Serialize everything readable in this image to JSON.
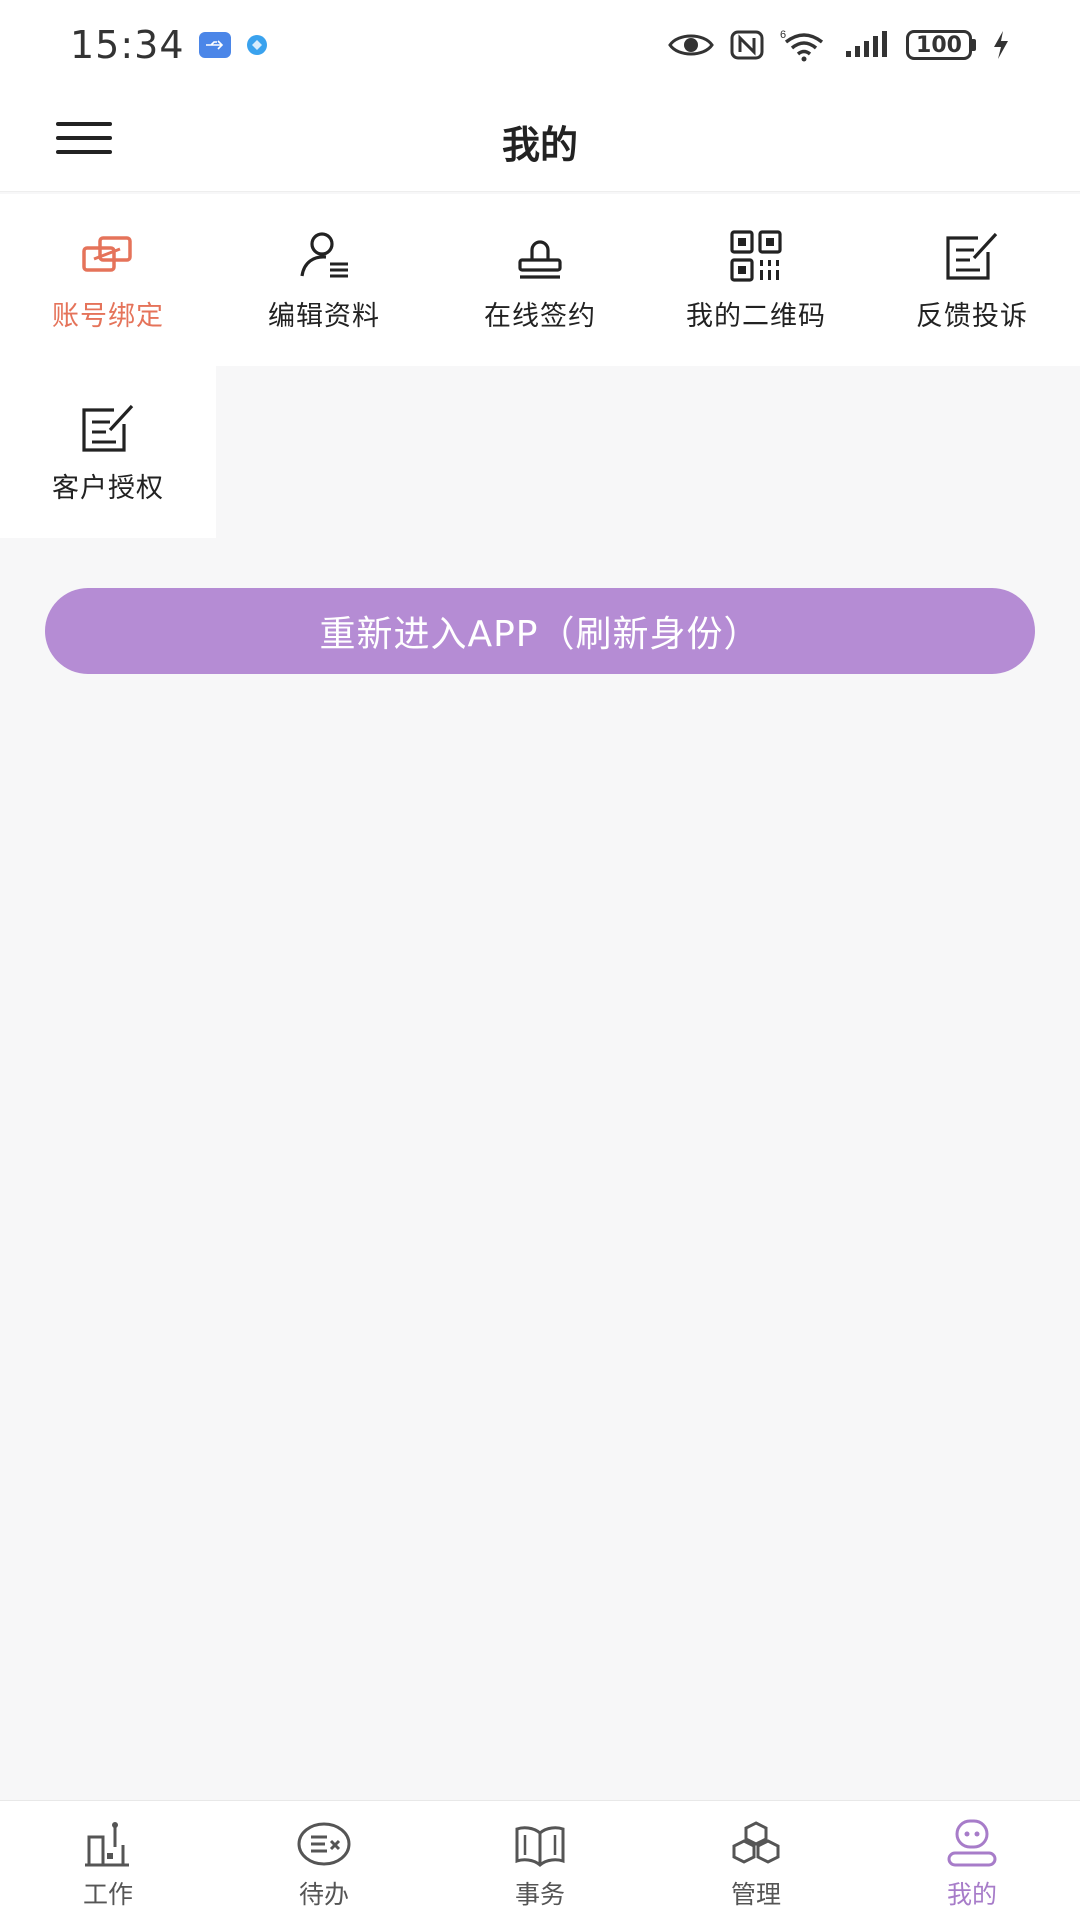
{
  "status_bar": {
    "time": "15:34",
    "battery": "100",
    "network_badge": "6"
  },
  "header": {
    "title": "我的"
  },
  "grid": {
    "items": [
      {
        "label": "账号绑定",
        "icon": "link-windows-icon",
        "active": true
      },
      {
        "label": "编辑资料",
        "icon": "user-edit-icon",
        "active": false
      },
      {
        "label": "在线签约",
        "icon": "stamp-icon",
        "active": false
      },
      {
        "label": "我的二维码",
        "icon": "qrcode-icon",
        "active": false
      },
      {
        "label": "反馈投诉",
        "icon": "edit-note-icon",
        "active": false
      },
      {
        "label": "客户授权",
        "icon": "edit-note-icon",
        "active": false
      }
    ]
  },
  "refresh_button": {
    "label": "重新进入APP（刷新身份）"
  },
  "bottom_nav": {
    "items": [
      {
        "label": "工作",
        "icon": "work-icon",
        "active": false
      },
      {
        "label": "待办",
        "icon": "todo-icon",
        "active": false
      },
      {
        "label": "事务",
        "icon": "book-icon",
        "active": false
      },
      {
        "label": "管理",
        "icon": "cubes-icon",
        "active": false
      },
      {
        "label": "我的",
        "icon": "profile-icon",
        "active": true
      }
    ]
  },
  "colors": {
    "accent_orange": "#e5735a",
    "accent_purple": "#b58cd4",
    "nav_active": "#a77cc9",
    "background": "#f7f7f8"
  }
}
